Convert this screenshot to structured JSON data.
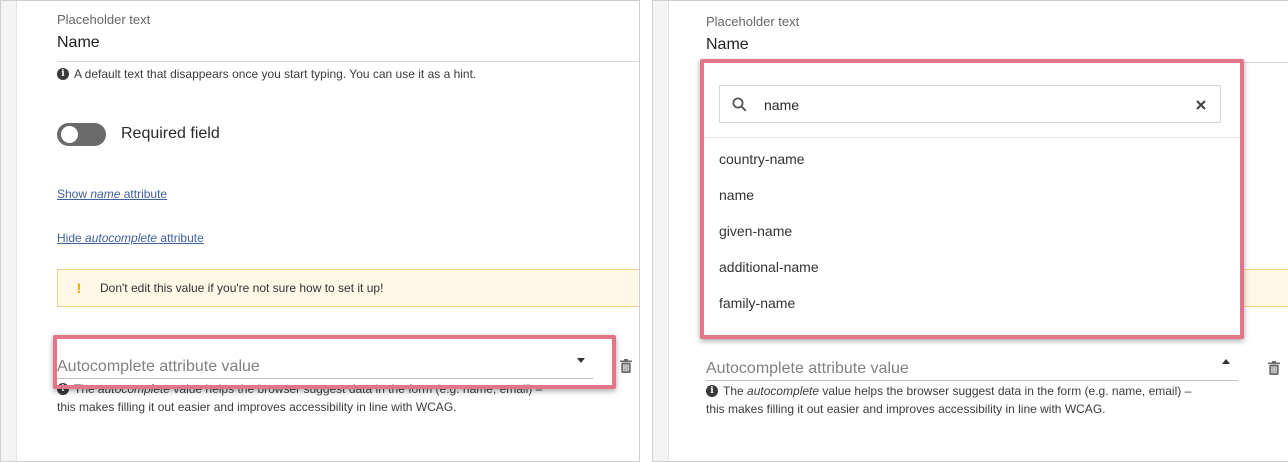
{
  "left": {
    "placeholder_label": "Placeholder text",
    "placeholder_value": "Name",
    "placeholder_hint": "A default text that disappears once you start typing. You can use it as a hint.",
    "required_label": "Required field",
    "required_on": false,
    "show_name_prefix": "Show ",
    "show_name_em": "name",
    "show_name_suffix": " attribute",
    "hide_auto_prefix": "Hide ",
    "hide_auto_em": "autocomplete",
    "hide_auto_suffix": " attribute",
    "warning_text": "Don't edit this value if you're not sure how to set it up!",
    "autocomplete_placeholder": "Autocomplete attribute value",
    "autocomplete_hint_line1_pre": "The ",
    "autocomplete_hint_line1_em": "autocomplete",
    "autocomplete_hint_line1_post": " value helps the browser suggest data in the form (e.g. name, email) –",
    "autocomplete_hint_line2": "this makes filling it out easier and improves accessibility in line with WCAG."
  },
  "right": {
    "placeholder_label": "Placeholder text",
    "placeholder_value": "Name",
    "search_value": "name",
    "options": [
      "country-name",
      "name",
      "given-name",
      "additional-name",
      "family-name"
    ],
    "autocomplete_placeholder": "Autocomplete attribute value",
    "autocomplete_hint_line1_pre": "The ",
    "autocomplete_hint_line1_em": "autocomplete",
    "autocomplete_hint_line1_post": " value helps the browser suggest data in the form (e.g. name, email) –",
    "autocomplete_hint_line2": "this makes filling it out easier and improves accessibility in line with WCAG."
  },
  "colors": {
    "highlight": "#e27589",
    "warning_bg": "#fff8e6",
    "warning_icon": "#f0a500",
    "link": "#3f5f9e",
    "toggle_off": "#6b6b6b"
  },
  "icons": {
    "info": "info-icon",
    "warning": "exclamation-icon",
    "search": "search-icon",
    "clear": "close-icon",
    "trash": "trash-icon",
    "dropdown_closed": "caret-down-icon",
    "dropdown_open": "caret-up-icon"
  }
}
